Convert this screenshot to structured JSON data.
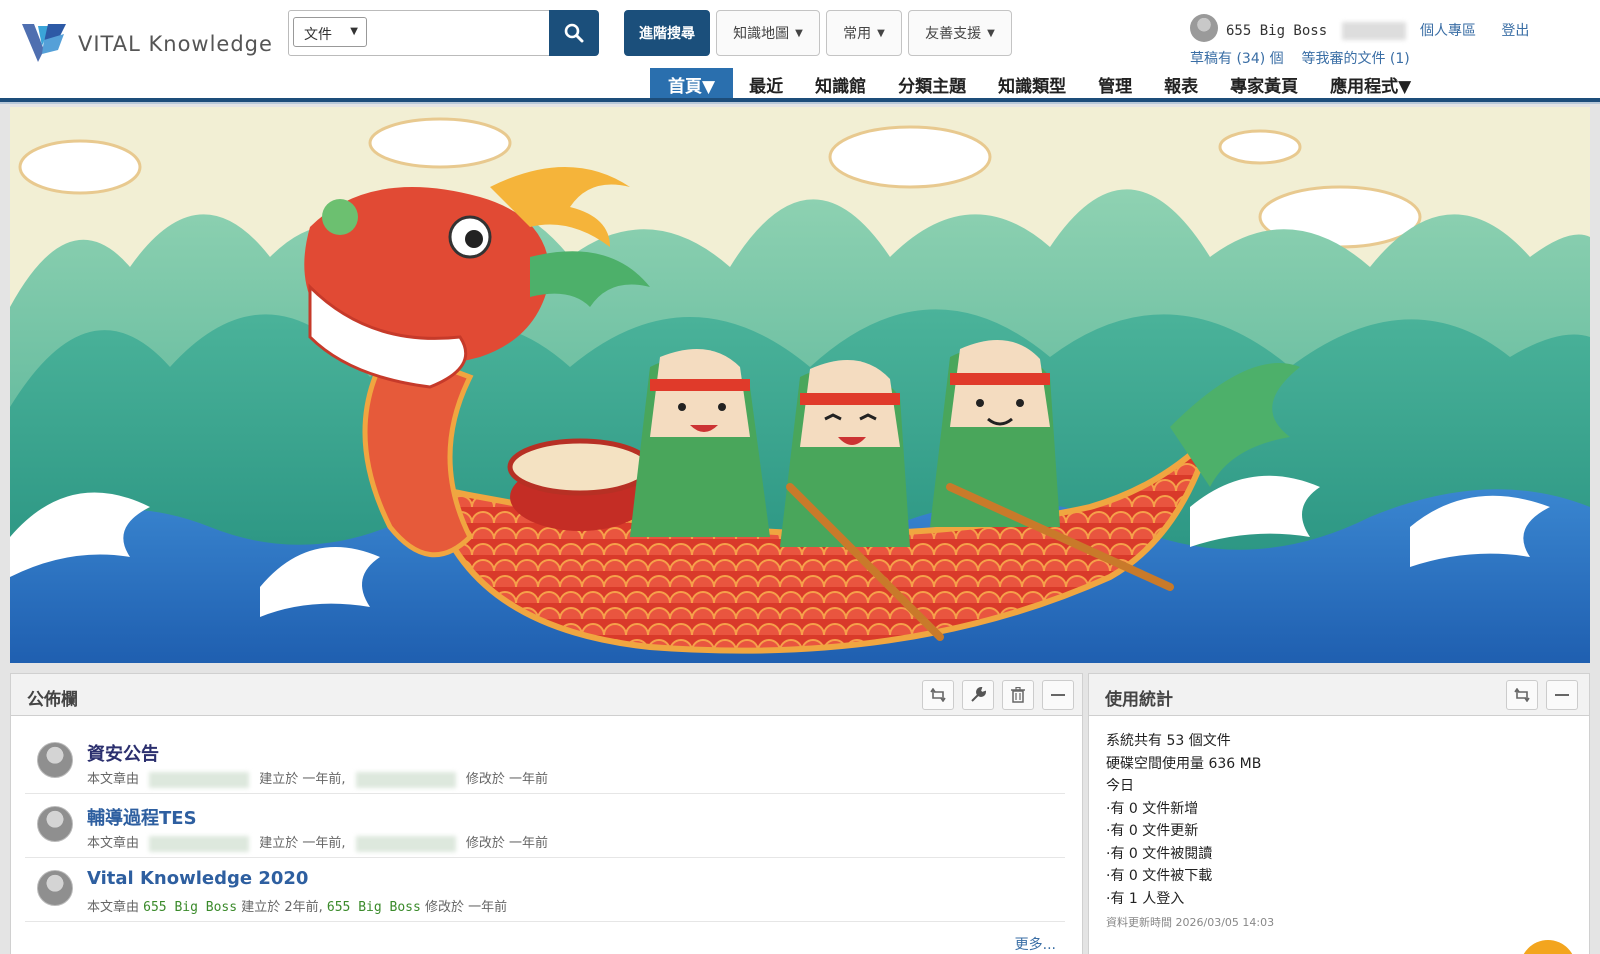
{
  "logo": {
    "brand": "VITAL Knowledge"
  },
  "search": {
    "scope": "文件",
    "placeholder": "",
    "button_icon": "search-icon"
  },
  "header_buttons": {
    "advanced_search": "進階搜尋",
    "knowledge_map": "知識地圖",
    "common": "常用",
    "friendly_support": "友善支援"
  },
  "user": {
    "name": "655 Big Boss",
    "personal_area": "個人專區",
    "logout": "登出",
    "drafts": "草稿有 (34) 個",
    "pending_review": "等我審的文件 (1)"
  },
  "nav": [
    {
      "label": "首頁▼",
      "active": true
    },
    {
      "label": "最近"
    },
    {
      "label": "知識館"
    },
    {
      "label": "分類主題"
    },
    {
      "label": "知識類型"
    },
    {
      "label": "管理"
    },
    {
      "label": "報表"
    },
    {
      "label": "專家黃頁"
    },
    {
      "label": "應用程式▼"
    }
  ],
  "banner": {
    "image": "dragon-boat-festival-illustration"
  },
  "bulletin": {
    "title": "公佈欄",
    "controls": [
      "refresh-icon",
      "wrench-icon",
      "trash-icon",
      "minimize-icon"
    ],
    "posts": [
      {
        "title": "資安公告",
        "meta_prefix": "本文章由",
        "meta_created": "建立於 一年前,",
        "meta_modified": "修改於 一年前"
      },
      {
        "title": "輔導過程TES",
        "meta_prefix": "本文章由",
        "meta_created": "建立於 一年前,",
        "meta_modified": "修改於 一年前"
      },
      {
        "title": "Vital Knowledge 2020",
        "meta_prefix": "本文章由",
        "author": "655 Big Boss",
        "meta_created": "建立於 2年前,",
        "modifier": "655 Big Boss",
        "meta_modified": "修改於 一年前"
      }
    ],
    "more": "更多..."
  },
  "stats": {
    "title": "使用統計",
    "controls": [
      "refresh-icon",
      "minimize-icon"
    ],
    "lines": [
      "系統共有 53 個文件",
      "硬碟空間使用量 636 MB",
      "今日",
      "·有 0 文件新增",
      "·有 0 文件更新",
      "·有 0 文件被閱讀",
      "·有 0 文件被下載",
      "·有 1 人登入"
    ],
    "updated": "資料更新時間 2026/03/05 14:03"
  },
  "colors": {
    "brand": "#1b4f7b",
    "nav_active": "#2a6fae",
    "link": "#3a6ea5",
    "green_name": "#3a8a2a"
  }
}
